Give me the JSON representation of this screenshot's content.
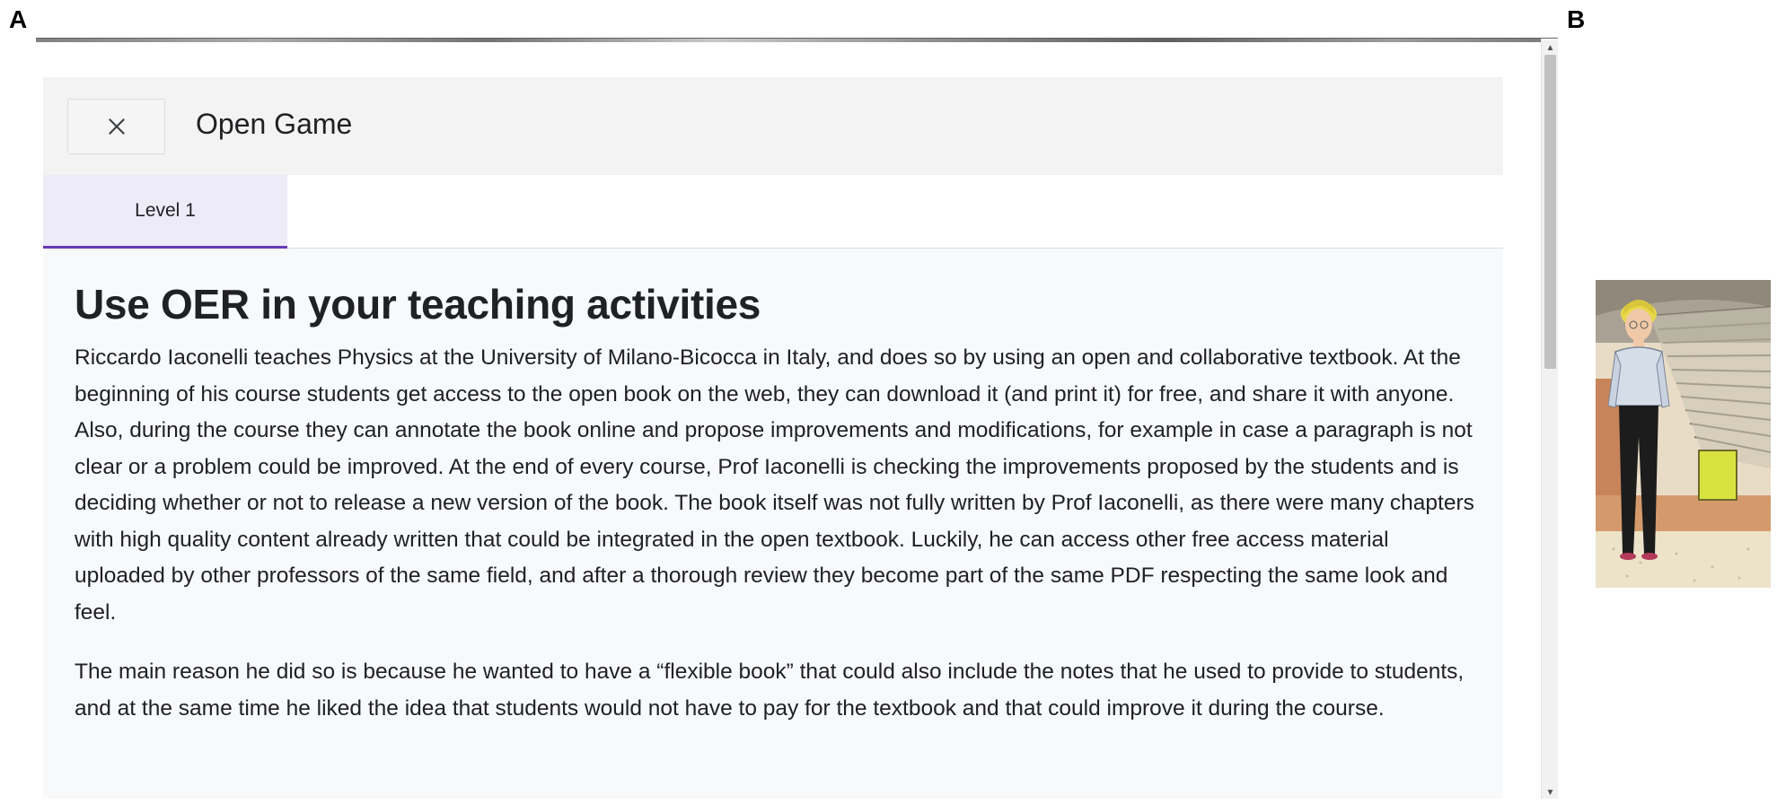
{
  "figure": {
    "panel_a_label": "A",
    "panel_b_label": "B"
  },
  "dialog": {
    "close_icon": "close-icon",
    "title": "Open Game",
    "tabs": [
      {
        "label": "Level 1",
        "active": true
      }
    ]
  },
  "content": {
    "heading": "Use OER in your teaching activities",
    "paragraphs": [
      "Riccardo Iaconelli teaches Physics at the University of Milano-Bicocca in Italy, and does so by using an open and collaborative textbook. At the beginning of his course students get access to the open book on the web, they can download it (and print it) for free, and share it with anyone. Also, during the course they can annotate the book online and propose improvements and modifications, for example in case a paragraph is not clear or a problem could be improved. At the end of every course, Prof Iaconelli is checking the improvements proposed by the students and is deciding whether or not to release a new version of the book. The book itself was not fully written by Prof Iaconelli, as there were many chapters with high quality content already written that could be integrated in the open textbook. Luckily, he can access other free access material uploaded by other professors of the same field, and after a thorough review they become part of the same PDF respecting the same look and feel.",
      "The main reason he did so is because he wanted to have a “flexible book” that could also include the notes that he used to provide to students, and at the same time he liked the idea that students would not have to pay for the textbook and that could improve it during the course."
    ]
  },
  "colors": {
    "tab_active_bg": "#ecebf7",
    "tab_indicator": "#673ab7",
    "header_bg": "#f3f3f3",
    "dialog_bg": "#f8f9fa"
  }
}
